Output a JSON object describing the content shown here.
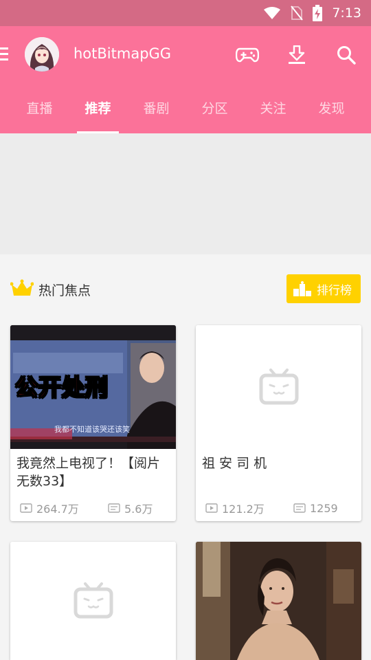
{
  "status_bar": {
    "time": "7:13"
  },
  "app_bar": {
    "username": "hotBitmapGG",
    "icons": [
      "menu-icon",
      "gamepad-icon",
      "download-icon",
      "search-icon"
    ]
  },
  "tabs": [
    {
      "label": "直播",
      "active": false
    },
    {
      "label": "推荐",
      "active": true
    },
    {
      "label": "番剧",
      "active": false
    },
    {
      "label": "分区",
      "active": false
    },
    {
      "label": "关注",
      "active": false
    },
    {
      "label": "发现",
      "active": false
    }
  ],
  "section": {
    "title": "热门焦点",
    "rank_button": "排行榜"
  },
  "cards": [
    {
      "title": "我竟然上电视了！【阅片无数33】",
      "plays": "264.7万",
      "danmaku": "5.6万",
      "thumb_overlay": "公开处刑",
      "thumb_subtitle": "我都不知道该哭还该笑"
    },
    {
      "title": "祖 安 司 机",
      "plays": "121.2万",
      "danmaku": "1259"
    },
    {
      "title": "",
      "plays": "",
      "danmaku": ""
    },
    {
      "title": "",
      "plays": "",
      "danmaku": ""
    }
  ],
  "colors": {
    "primary": "#fb7299",
    "status_bar": "#d46a85",
    "accent": "#ffd100"
  }
}
